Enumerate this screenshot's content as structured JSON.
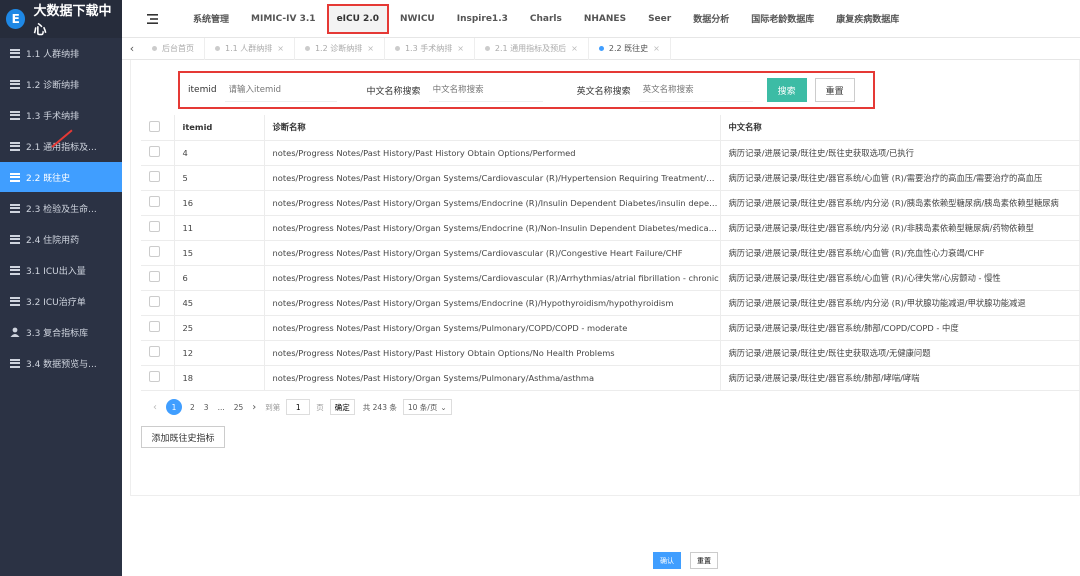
{
  "app": {
    "title": "大数据下载中心",
    "logo_letter": "E"
  },
  "sidebar": {
    "items": [
      {
        "label": "1.1 人群纳排",
        "icon": "list-icon"
      },
      {
        "label": "1.2 诊断纳排",
        "icon": "list-icon"
      },
      {
        "label": "1.3 手术纳排",
        "icon": "list-icon"
      },
      {
        "label": "2.1 通用指标及...",
        "icon": "list-icon"
      },
      {
        "label": "2.2 既往史",
        "icon": "list-icon"
      },
      {
        "label": "2.3 检验及生命...",
        "icon": "list-icon"
      },
      {
        "label": "2.4 住院用药",
        "icon": "list-icon"
      },
      {
        "label": "3.1 ICU出入量",
        "icon": "list-icon"
      },
      {
        "label": "3.2 ICU治疗单",
        "icon": "list-icon"
      },
      {
        "label": "3.3 复合指标库",
        "icon": "user-icon"
      },
      {
        "label": "3.4 数据预览与...",
        "icon": "list-icon"
      }
    ]
  },
  "topmenu": {
    "items": [
      "系统管理",
      "MIMIC-IV 3.1",
      "eICU 2.0",
      "NWICU",
      "Inspire1.3",
      "Charls",
      "NHANES",
      "Seer",
      "数据分析",
      "国际老龄数据库",
      "康复疾病数据库"
    ]
  },
  "tabs": {
    "items": [
      {
        "label": "后台首页",
        "closable": false
      },
      {
        "label": "1.1 人群纳排",
        "closable": true
      },
      {
        "label": "1.2 诊断纳排",
        "closable": true
      },
      {
        "label": "1.3 手术纳排",
        "closable": true
      },
      {
        "label": "2.1 通用指标及预后",
        "closable": true
      },
      {
        "label": "2.2 既往史",
        "closable": true
      }
    ]
  },
  "search": {
    "itemid_label": "itemid",
    "itemid_placeholder": "请输入itemid",
    "cn_label": "中文名称搜索",
    "cn_placeholder": "中文名称搜索",
    "en_label": "英文名称搜索",
    "en_placeholder": "英文名称搜索",
    "search_button": "搜索",
    "reset_button": "重置"
  },
  "table": {
    "headers": [
      "itemid",
      "诊断名称",
      "中文名称"
    ],
    "rows": [
      [
        "4",
        "notes/Progress Notes/Past History/Past History Obtain Options/Performed",
        "病历记录/进展记录/既往史/既往史获取选项/已执行"
      ],
      [
        "5",
        "notes/Progress Notes/Past History/Organ Systems/Cardiovascular (R)/Hypertension Requiring Treatment/hyperten...",
        "病历记录/进展记录/既往史/器官系统/心血管 (R)/需要治疗的高血压/需要治疗的高血压"
      ],
      [
        "16",
        "notes/Progress Notes/Past History/Organ Systems/Endocrine (R)/Insulin Dependent Diabetes/insulin dependent d...",
        "病历记录/进展记录/既往史/器官系统/内分泌 (R)/胰岛素依赖型糖尿病/胰岛素依赖型糖尿病"
      ],
      [
        "11",
        "notes/Progress Notes/Past History/Organ Systems/Endocrine (R)/Non-Insulin Dependent Diabetes/medication de...",
        "病历记录/进展记录/既往史/器官系统/内分泌 (R)/非胰岛素依赖型糖尿病/药物依赖型"
      ],
      [
        "15",
        "notes/Progress Notes/Past History/Organ Systems/Cardiovascular (R)/Congestive Heart Failure/CHF",
        "病历记录/进展记录/既往史/器官系统/心血管 (R)/充血性心力衰竭/CHF"
      ],
      [
        "6",
        "notes/Progress Notes/Past History/Organ Systems/Cardiovascular (R)/Arrhythmias/atrial fibrillation - chronic",
        "病历记录/进展记录/既往史/器官系统/心血管 (R)/心律失常/心房颤动 - 慢性"
      ],
      [
        "45",
        "notes/Progress Notes/Past History/Organ Systems/Endocrine (R)/Hypothyroidism/hypothyroidism",
        "病历记录/进展记录/既往史/器官系统/内分泌 (R)/甲状腺功能减退/甲状腺功能减退"
      ],
      [
        "25",
        "notes/Progress Notes/Past History/Organ Systems/Pulmonary/COPD/COPD - moderate",
        "病历记录/进展记录/既往史/器官系统/肺部/COPD/COPD - 中度"
      ],
      [
        "12",
        "notes/Progress Notes/Past History/Past History Obtain Options/No Health Problems",
        "病历记录/进展记录/既往史/既往史获取选项/无健康问题"
      ],
      [
        "18",
        "notes/Progress Notes/Past History/Organ Systems/Pulmonary/Asthma/asthma",
        "病历记录/进展记录/既往史/器官系统/肺部/哮喘/哮喘"
      ]
    ]
  },
  "pagination": {
    "pages": [
      "1",
      "2",
      "3",
      "...",
      "25"
    ],
    "current": "1",
    "goto_label": "到第",
    "goto_value": "1",
    "page_unit": "页",
    "confirm": "确定",
    "total": "共 243 条",
    "page_size": "10 条/页"
  },
  "actions": {
    "add_button": "添加既往史指标",
    "confirm_button": "确认",
    "reset_button": "重置"
  }
}
